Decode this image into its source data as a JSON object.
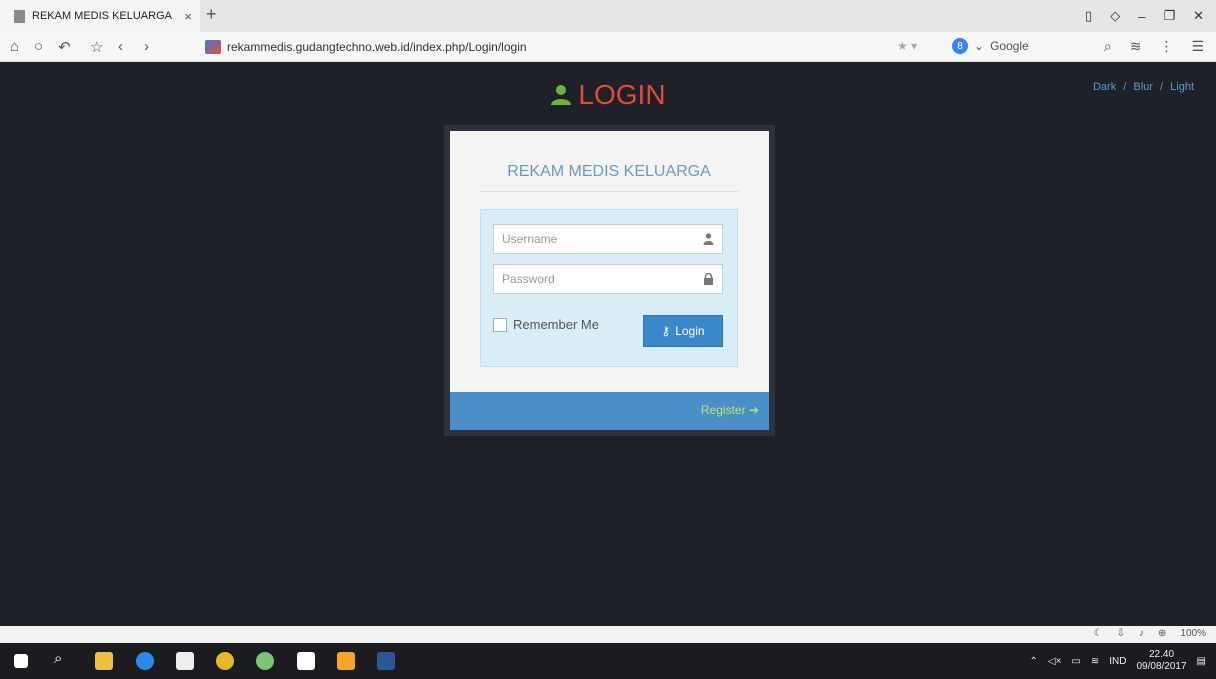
{
  "browser": {
    "tab_title": "REKAM MEDIS KELUARGA",
    "tab_close": "×",
    "new_tab": "+",
    "url": "rekammedis.gudangtechno.web.id/index.php/Login/login",
    "search_engine": "Google",
    "zoom": "100%"
  },
  "page": {
    "title": "LOGIN",
    "themes": [
      "Dark",
      "Blur",
      "Light"
    ],
    "theme_sep": "/",
    "card_title": "REKAM MEDIS KELUARGA",
    "username_placeholder": "Username",
    "password_placeholder": "Password",
    "remember_label": "Remember Me",
    "login_label": "Login",
    "register_label": "Register"
  },
  "taskbar": {
    "lang": "IND",
    "time": "22.40",
    "date": "09/08/2017"
  },
  "colors": {
    "title": "#e04a36",
    "user_icon": "#6db33f",
    "accent": "#3a87c9",
    "register": "#b7e86b"
  }
}
